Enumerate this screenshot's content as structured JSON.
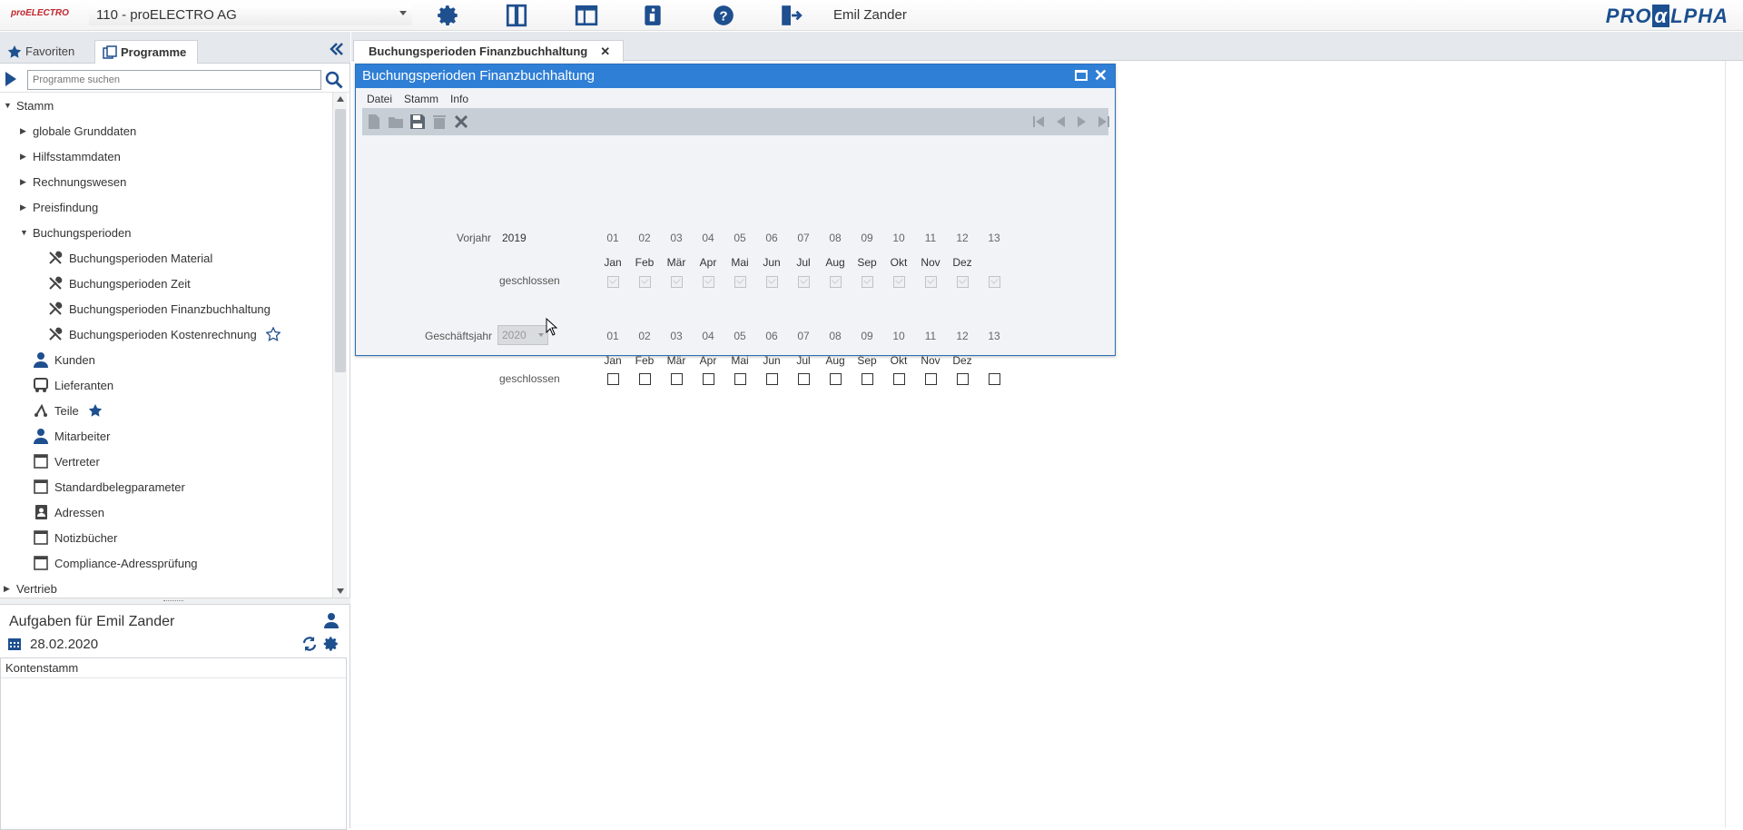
{
  "topbar": {
    "logo_text": "proELECTRO",
    "company_select": "110 - proELECTRO AG",
    "user_name": "Emil Zander",
    "brand_pre": "PRO",
    "brand_mark": "α",
    "brand_post": "LPHA",
    "icons": [
      "gear-icon",
      "panel-icon",
      "layout-icon",
      "info-icon",
      "help-icon",
      "logout-icon"
    ]
  },
  "left": {
    "tabs": [
      {
        "label": "Favoriten",
        "icon": "star-icon"
      },
      {
        "label": "Programme",
        "icon": "programs-icon"
      }
    ],
    "search_placeholder": "Programme suchen",
    "tree": [
      {
        "label": "Stamm",
        "level": 0,
        "arrow": "▼"
      },
      {
        "label": "globale Grunddaten",
        "level": 1,
        "arrow": "▶"
      },
      {
        "label": "Hilfsstammdaten",
        "level": 1,
        "arrow": "▶"
      },
      {
        "label": "Rechnungswesen",
        "level": 1,
        "arrow": "▶"
      },
      {
        "label": "Preisfindung",
        "level": 1,
        "arrow": "▶"
      },
      {
        "label": "Buchungsperioden",
        "level": 1,
        "arrow": "▼"
      },
      {
        "label": "Buchungsperioden Material",
        "level": 2,
        "icon": "tools-icon"
      },
      {
        "label": "Buchungsperioden Zeit",
        "level": 2,
        "icon": "tools-icon"
      },
      {
        "label": "Buchungsperioden Finanzbuchhaltung",
        "level": 2,
        "icon": "tools-icon"
      },
      {
        "label": "Buchungsperioden Kostenrechnung",
        "level": 2,
        "icon": "tools-icon",
        "star": "outline"
      },
      {
        "label": "Kunden",
        "level": 1,
        "icon": "person-icon"
      },
      {
        "label": "Lieferanten",
        "level": 1,
        "icon": "truck-icon"
      },
      {
        "label": "Teile",
        "level": 1,
        "icon": "parts-icon",
        "star": "filled"
      },
      {
        "label": "Mitarbeiter",
        "level": 1,
        "icon": "person-icon"
      },
      {
        "label": "Vertreter",
        "level": 1,
        "icon": "window-icon"
      },
      {
        "label": "Standardbelegparameter",
        "level": 1,
        "icon": "window-icon"
      },
      {
        "label": "Adressen",
        "level": 1,
        "icon": "addressbook-icon"
      },
      {
        "label": "Notizbücher",
        "level": 1,
        "icon": "window-icon"
      },
      {
        "label": "Compliance-Adressprüfung",
        "level": 1,
        "icon": "window-icon"
      },
      {
        "label": "Vertrieb",
        "level": 0,
        "arrow": "▶"
      }
    ],
    "tasks": {
      "title": "Aufgaben für Emil Zander",
      "date": "28.02.2020",
      "rows": [
        "Kontenstamm"
      ]
    }
  },
  "main": {
    "tab_label": "Buchungsperioden Finanzbuchhaltung",
    "tab_close": "✕"
  },
  "dialog": {
    "title": "Buchungsperioden Finanzbuchhaltung",
    "close": "✕",
    "menu": [
      "Datei",
      "Stamm",
      "Info"
    ],
    "prev_year_label": "Vorjahr",
    "prev_year_value": "2019",
    "fiscal_year_label": "Geschäftsjahr",
    "fiscal_year_value": "2020",
    "closed_label": "geschlossen",
    "period_numbers": [
      "01",
      "02",
      "03",
      "04",
      "05",
      "06",
      "07",
      "08",
      "09",
      "10",
      "11",
      "12",
      "13"
    ],
    "months": [
      "Jan",
      "Feb",
      "Mär",
      "Apr",
      "Mai",
      "Jun",
      "Jul",
      "Aug",
      "Sep",
      "Okt",
      "Nov",
      "Dez",
      ""
    ],
    "prev_year_closed": [
      true,
      true,
      true,
      true,
      true,
      true,
      true,
      true,
      true,
      true,
      true,
      true,
      true
    ],
    "current_year_closed": [
      false,
      false,
      false,
      false,
      false,
      false,
      false,
      false,
      false,
      false,
      false,
      false,
      false
    ]
  },
  "colors": {
    "accent": "#2f7fd6",
    "brand": "#1b4f8f",
    "toolbar": "#c7ced6"
  }
}
